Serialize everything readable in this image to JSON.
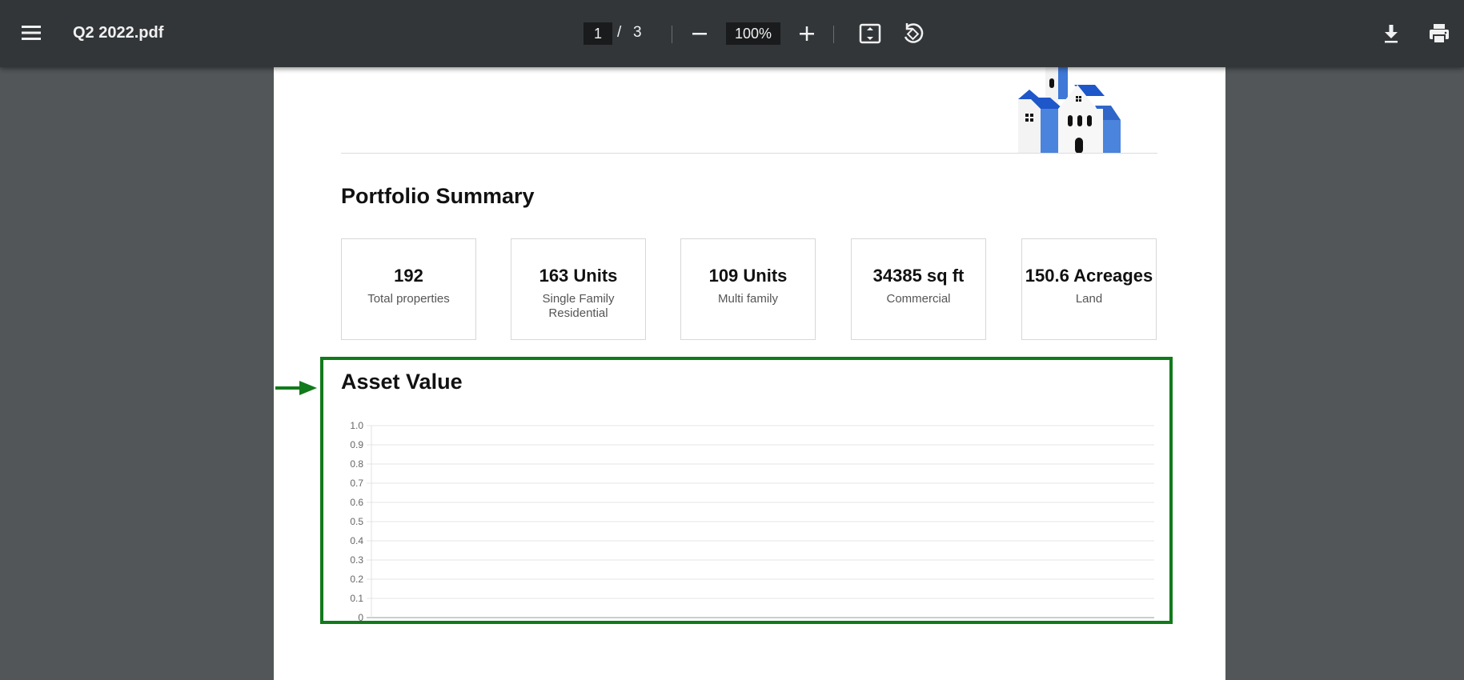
{
  "toolbar": {
    "file_title": "Q2 2022.pdf",
    "current_page": "1",
    "page_separator": "/",
    "total_pages": "3",
    "zoom": "100%",
    "icons": [
      "menu-icon",
      "minus-icon",
      "plus-icon",
      "fit-page-icon",
      "rotate-icon",
      "download-icon",
      "print-icon"
    ]
  },
  "document": {
    "portfolio_heading": "Portfolio Summary",
    "cards": [
      {
        "value": "192",
        "label": "Total properties"
      },
      {
        "value": "163 Units",
        "label": "Single Family Residential"
      },
      {
        "value": "109 Units",
        "label": "Multi family"
      },
      {
        "value": "34385 sq ft",
        "label": "Commercial"
      },
      {
        "value": "150.6 Acreages",
        "label": "Land"
      }
    ],
    "asset_heading": "Asset Value"
  },
  "chart_data": {
    "type": "line",
    "title": "",
    "xlabel": "",
    "ylabel": "",
    "ylim": [
      0,
      1.0
    ],
    "y_ticks": [
      "0",
      "0.1",
      "0.2",
      "0.3",
      "0.4",
      "0.5",
      "0.6",
      "0.7",
      "0.8",
      "0.9",
      "1.0"
    ],
    "series": [],
    "grid": true
  },
  "colors": {
    "toolbar_bg": "#323639",
    "viewer_bg": "#525659",
    "highlight": "#117a1b",
    "logo_blue": "#2f66c8"
  }
}
